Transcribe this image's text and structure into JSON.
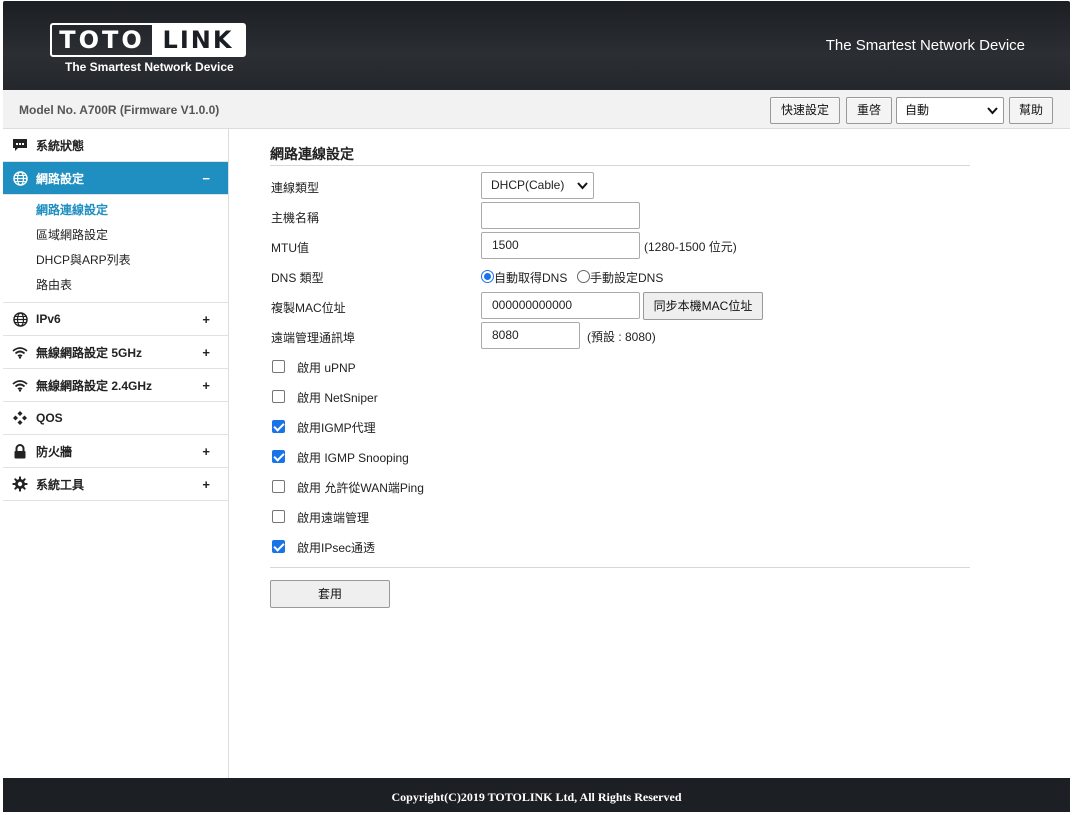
{
  "header": {
    "logo_left": "TOTO",
    "logo_right": "LINK",
    "logo_tagline": "The Smartest Network Device",
    "slogan": "The Smartest Network Device"
  },
  "subbar": {
    "model": "Model No. A700R (Firmware V1.0.0)",
    "quick_setup": "快速設定",
    "reboot": "重啓",
    "language": "自動",
    "help": "幫助"
  },
  "sidebar": {
    "items": [
      {
        "label": "系統狀態",
        "icon": "chat-icon",
        "sign": ""
      },
      {
        "label": "網路設定",
        "icon": "globe-icon",
        "sign": "−"
      },
      {
        "label": "IPv6",
        "icon": "globe-icon",
        "sign": "+"
      },
      {
        "label": "無線網路設定 5GHz",
        "icon": "wifi-icon",
        "sign": "+"
      },
      {
        "label": "無線網路設定 2.4GHz",
        "icon": "wifi-icon",
        "sign": "+"
      },
      {
        "label": "QOS",
        "icon": "qos-icon",
        "sign": ""
      },
      {
        "label": "防火牆",
        "icon": "lock-icon",
        "sign": "+"
      },
      {
        "label": "系統工具",
        "icon": "gear-icon",
        "sign": "+"
      }
    ],
    "subitems": [
      "網路連線設定",
      "區域網路設定",
      "DHCP與ARP列表",
      "路由表"
    ]
  },
  "main": {
    "title": "網路連線設定",
    "connection_type_label": "連線類型",
    "connection_type_value": "DHCP(Cable)",
    "hostname_label": "主機名稱",
    "hostname_value": "",
    "mtu_label": "MTU值",
    "mtu_value": "1500",
    "mtu_hint": "(1280-1500 位元)",
    "dns_type_label": "DNS 類型",
    "dns_auto": "自動取得DNS",
    "dns_manual": "手動設定DNS",
    "mac_clone_label": "複製MAC位址",
    "mac_value": "000000000000",
    "mac_sync_button": "同步本機MAC位址",
    "remote_port_label": "遠端管理通訊埠",
    "remote_port_value": "8080",
    "remote_port_hint": "(預設 : 8080)",
    "checkboxes": [
      {
        "label": "啟用 uPNP",
        "checked": false
      },
      {
        "label": "啟用 NetSniper",
        "checked": false
      },
      {
        "label": "啟用IGMP代理",
        "checked": true
      },
      {
        "label": "啟用 IGMP Snooping",
        "checked": true
      },
      {
        "label": "啟用 允許從WAN端Ping",
        "checked": false
      },
      {
        "label": "啟用遠端管理",
        "checked": false
      },
      {
        "label": "啟用IPsec通透",
        "checked": true
      }
    ],
    "apply_button": "套用"
  },
  "footer": {
    "copyright": "Copyright(C)2019 TOTOLINK Ltd, All Rights Reserved"
  },
  "colors": {
    "accent": "#1f8fc1",
    "header_bg": "#24272b",
    "checkbox_on": "#1b73e8"
  }
}
